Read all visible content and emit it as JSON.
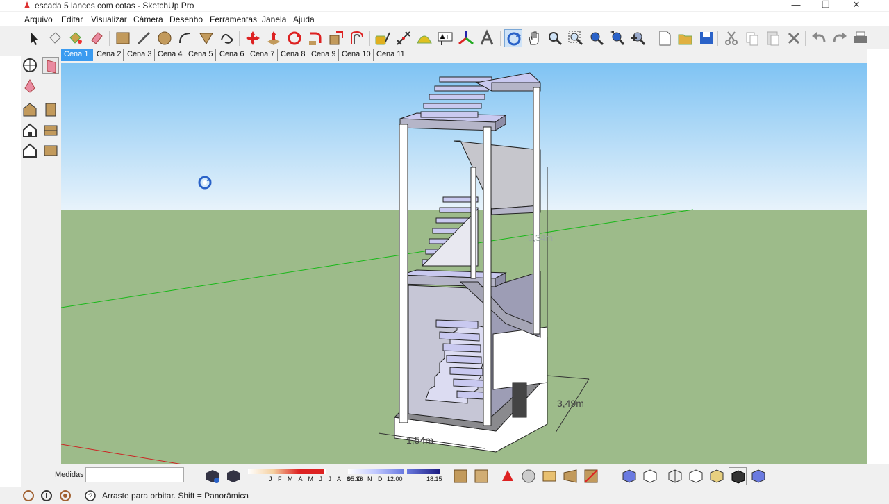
{
  "window": {
    "title": "escada 5 lances com cotas - SketchUp Pro",
    "minimize_glyph": "—",
    "restore_glyph": "❐",
    "close_glyph": "✕"
  },
  "menu": [
    "Arquivo",
    "Editar",
    "Visualizar",
    "Câmera",
    "Desenho",
    "Ferramentas",
    "Janela",
    "Ajuda"
  ],
  "scenes": [
    "Cena 1",
    "Cena 2",
    "Cena 3",
    "Cena 4",
    "Cena 5",
    "Cena 6",
    "Cena 7",
    "Cena 8",
    "Cena 9",
    "Cena 10",
    "Cena 11"
  ],
  "active_scene": "Cena 1",
  "dimensions": {
    "height": "6,34m",
    "depth": "3,49m",
    "width": "1,54m"
  },
  "measurements": {
    "label": "Medidas",
    "value": ""
  },
  "shadows": {
    "months": "J F M A M J J A S O N D",
    "time_start": "05:36",
    "time_mid": "12:00",
    "time_end": "18:15"
  },
  "status": {
    "hint": "Arraste para orbitar. Shift = Panorâmica"
  },
  "colors": {
    "sky_top": "#7fc3f3",
    "sky_bottom": "#e8f3fb",
    "ground": "#9dbb8a",
    "green_axis": "#17b817",
    "red_axis": "#cc2222",
    "active_tab": "#3b9bf0",
    "face_front": "#ffffff",
    "face_back": "#b5b5c8",
    "face_top": "#c9c9f0"
  },
  "icons": {
    "toolbar": [
      "select-icon",
      "eraser-component-icon",
      "paint-bucket-icon",
      "eraser-icon",
      "rectangle-icon",
      "pencil-line-icon",
      "circle-icon",
      "arc-icon",
      "polygon-icon",
      "freehand-icon",
      "move-icon",
      "push-pull-icon",
      "rotate-icon",
      "follow-me-icon",
      "scale-icon",
      "offset-icon",
      "tape-measure-icon",
      "dimension-icon",
      "protractor-icon",
      "text-icon",
      "axes-icon",
      "3d-text-icon",
      "orbit-icon",
      "pan-icon",
      "zoom-icon",
      "zoom-window-icon",
      "zoom-extents-icon",
      "previous-view-icon",
      "next-view-icon",
      "new-file-icon",
      "open-file-icon",
      "save-icon",
      "cut-icon",
      "copy-icon",
      "paste-icon",
      "delete-icon",
      "undo-icon",
      "redo-icon",
      "print-icon"
    ]
  }
}
